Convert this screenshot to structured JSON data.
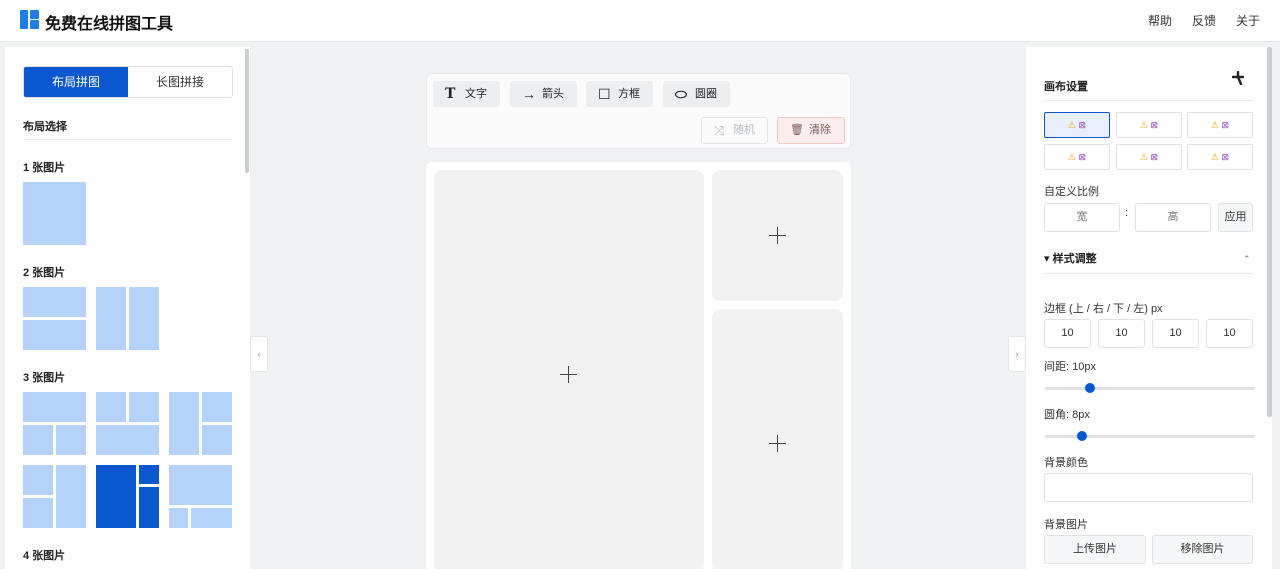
{
  "header": {
    "title": "免费在线拼图工具",
    "nav": [
      "帮助",
      "反馈",
      "关于"
    ]
  },
  "left": {
    "tabs": [
      "布局拼图",
      "长图拼接"
    ],
    "active_tab": "布局拼图",
    "section_title": "布局选择",
    "groups": [
      "1 张图片",
      "2 张图片",
      "3 张图片",
      "4 张图片"
    ],
    "collapse_glyph": "‹"
  },
  "toolbar": {
    "text": {
      "icon": "T",
      "label": "文字"
    },
    "arrow": {
      "icon": "→",
      "label": "箭头"
    },
    "rect": {
      "icon": "☐",
      "label": "方框"
    },
    "circle": {
      "icon": "⬭",
      "label": "圆圈"
    },
    "random": {
      "icon": "⤨",
      "label": "随机"
    },
    "clear": {
      "icon": "🗑",
      "label": "清除"
    }
  },
  "right": {
    "collapse_glyph": "›",
    "canvas_settings_title": "画布设置",
    "pin_icon": "pin-icon",
    "ratio_placeholder": "⚠ ⊠",
    "custom_ratio_label": "自定义比例",
    "width_placeholder": "宽",
    "separator": ":",
    "height_placeholder": "高",
    "apply_label": "应用",
    "style_title": "▾ 样式调整",
    "collapse_up": "⌃",
    "border_label": "边框 (上 / 右 / 下 / 左) px",
    "border_values": [
      "10",
      "10",
      "10",
      "10"
    ],
    "spacing_label": "间距: 10px",
    "spacing_value": 10,
    "radius_label": "圆角: 8px",
    "radius_value": 8,
    "bg_color_label": "背景颜色",
    "bg_image_label": "背景图片",
    "upload_label": "上传图片",
    "remove_label": "移除图片"
  },
  "colors": {
    "accent": "#0b57d0",
    "thumb": "#b5d2fa",
    "cell": "#f2f2f3"
  }
}
